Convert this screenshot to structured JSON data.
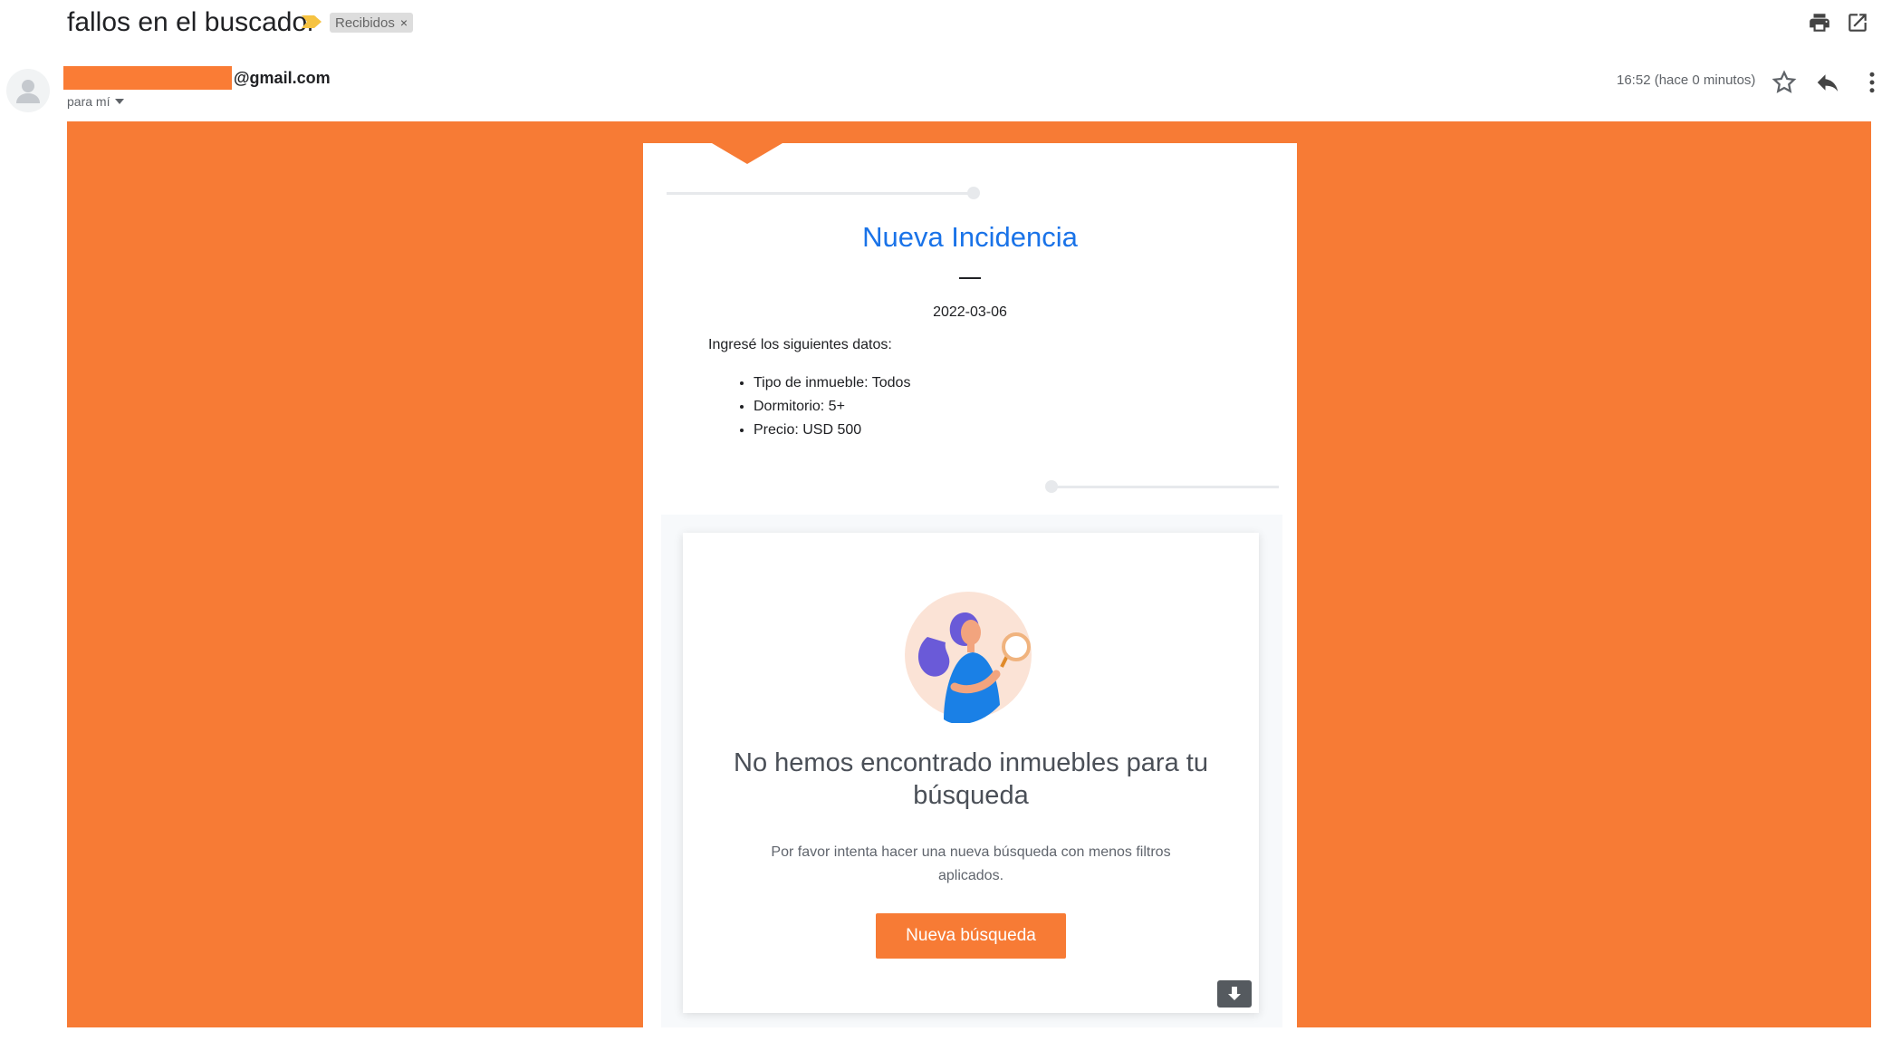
{
  "header": {
    "subject": "fallos en el buscador",
    "label": "Recibidos",
    "label_close": "×"
  },
  "sender": {
    "email_suffix": "@gmail.com",
    "to_me": "para mí",
    "timestamp": "16:52 (hace 0 minutos)"
  },
  "icons": {
    "importance": "importance-marker-icon",
    "print": "print-icon",
    "open_new_window": "open-in-new-window-icon",
    "star": "star-icon",
    "reply": "reply-icon",
    "more": "more-vert-icon",
    "avatar": "avatar-icon",
    "download": "download-icon"
  },
  "email": {
    "title": "Nueva Incidencia",
    "date": "2022-03-06",
    "intro": "Ingresé los siguientes datos:",
    "data_items": [
      "Tipo de inmueble: Todos",
      "Dormitorio: 5+",
      "Precio: USD 500"
    ],
    "results": {
      "heading": "No hemos encontrado inmuebles para tu búsqueda",
      "subtext": "Por favor intenta hacer una nueva búsqueda con menos filtros aplicados.",
      "button": "Nueva búsqueda"
    }
  },
  "colors": {
    "brand_orange": "#f77b35",
    "title_blue": "#1a73e8",
    "label_bg": "#dddddd",
    "importance_yellow": "#f6c342"
  }
}
